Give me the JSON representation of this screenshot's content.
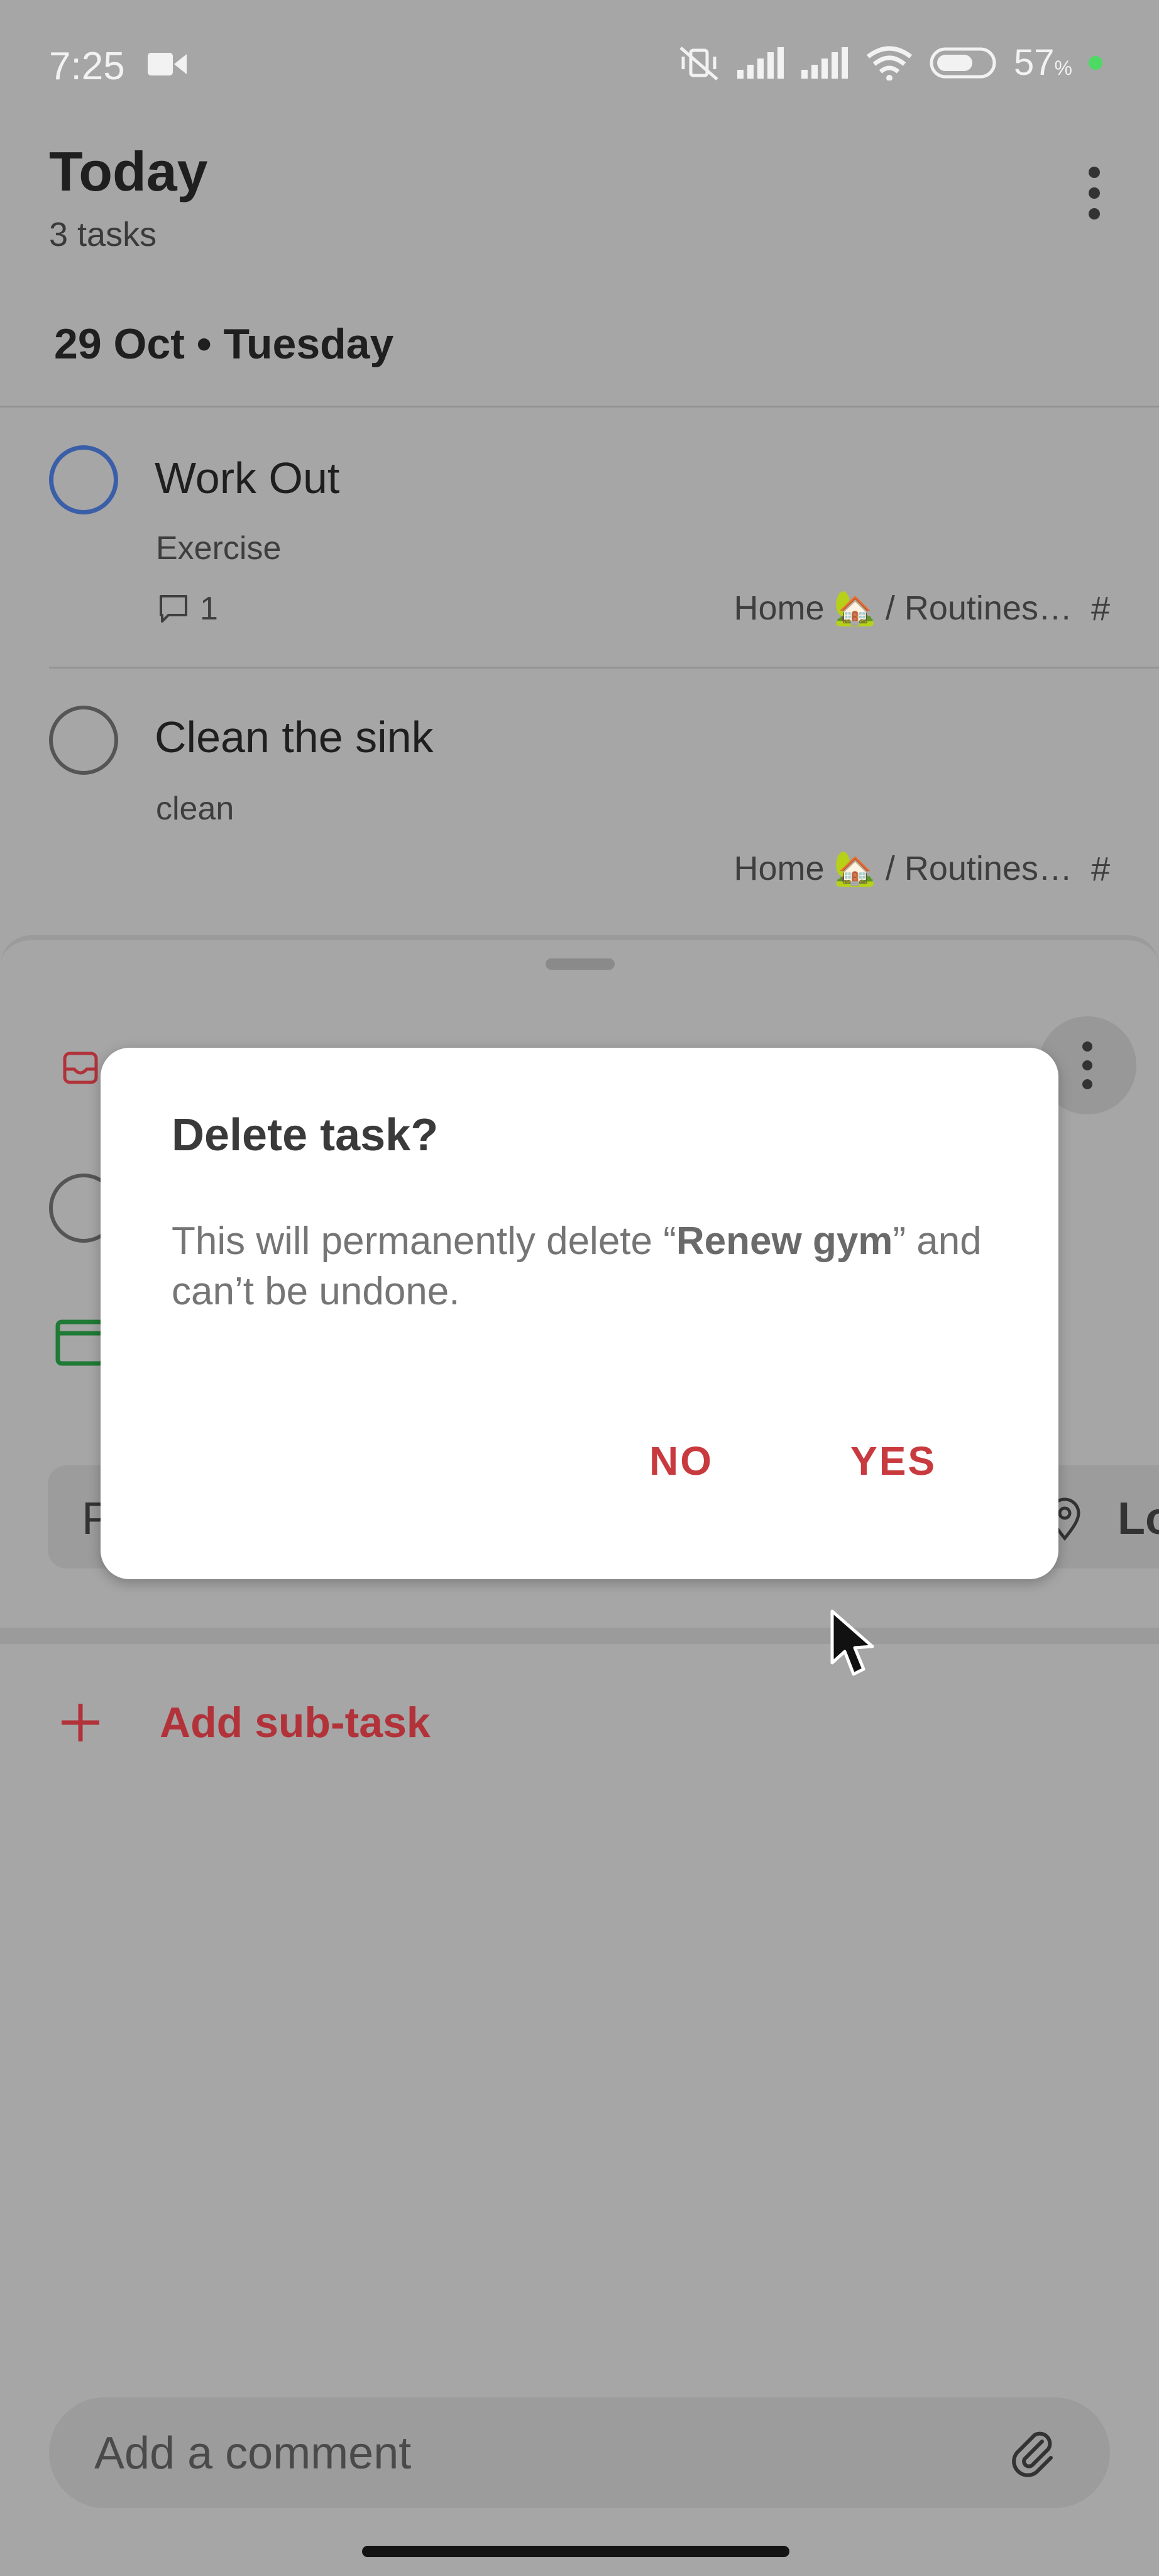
{
  "status_bar": {
    "time": "7:25",
    "battery": "57",
    "battery_unit": "%",
    "icons": [
      "video-camera-icon",
      "mute-vibrate-icon",
      "signal-icon",
      "signal-icon",
      "wifi-icon",
      "battery-icon"
    ]
  },
  "header": {
    "title": "Today",
    "subtitle": "3 tasks"
  },
  "section": {
    "date": "29 Oct • Tuesday"
  },
  "tasks": [
    {
      "title": "Work Out",
      "description": "Exercise",
      "comment_count": "1",
      "project": "Home 🏡 / Routines…",
      "project_tag": "#"
    },
    {
      "title": "Clean the sink",
      "description": "clean",
      "project": "Home 🏡 / Routines…",
      "project_tag": "#"
    }
  ],
  "dialog": {
    "title": "Delete task?",
    "body_prefix": "This will permanently delete “",
    "task_name": "Renew gym",
    "body_suffix": "” and can’t be undone.",
    "no_label": "NO",
    "yes_label": "YES"
  },
  "sheet": {
    "partial_left_text": "P",
    "partial_right_text": "Lo",
    "add_subtask_label": "Add sub-task",
    "comment_placeholder": "Add a comment"
  },
  "colors": {
    "accent_red": "#c83a3e",
    "priority_blue": "#3a5fa8",
    "scrim": "#a6a6a6"
  }
}
